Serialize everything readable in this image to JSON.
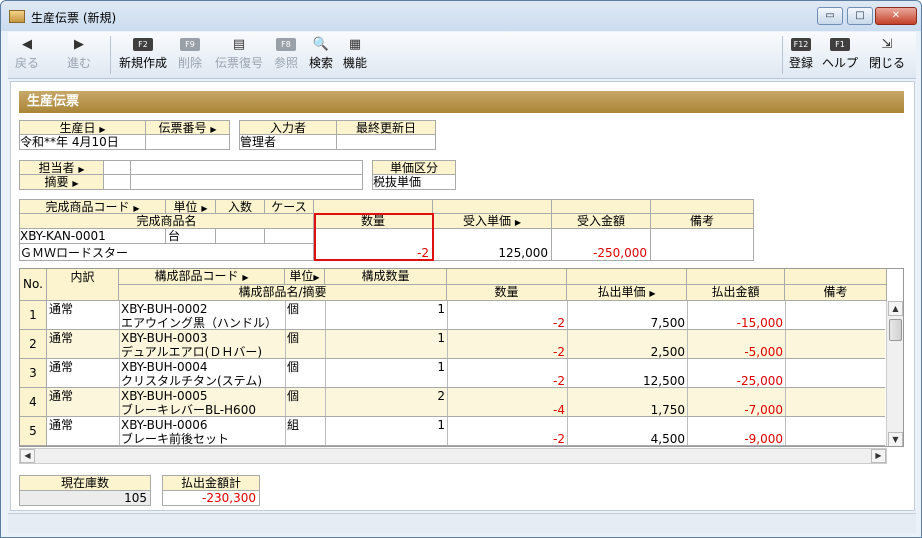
{
  "window": {
    "title": "生産伝票 (新規)",
    "min": "▭",
    "max": "□",
    "close": "✕"
  },
  "toolbar": {
    "back": {
      "label": "戻る",
      "icon": "◀"
    },
    "forward": {
      "label": "進む",
      "icon": "▶"
    },
    "new": {
      "label": "新規作成",
      "key": "F2"
    },
    "delete": {
      "label": "削除",
      "key": "F9"
    },
    "restore": {
      "label": "伝票復号",
      "icon": "▤"
    },
    "refer": {
      "label": "参照",
      "key": "F8"
    },
    "search": {
      "label": "検索",
      "icon": "🔍"
    },
    "function": {
      "label": "機能",
      "icon": "▦"
    },
    "register": {
      "label": "登録",
      "key": "F12"
    },
    "help": {
      "label": "ヘルプ",
      "key": "F1"
    },
    "close": {
      "label": "閉じる",
      "icon": "⇲"
    }
  },
  "section_title": "生産伝票",
  "header": {
    "prod_date_label": "生産日",
    "slip_no_label": "伝票番号",
    "prod_date": "令和**年 4月10日",
    "slip_no": "",
    "inputter_label": "入力者",
    "last_update_label": "最終更新日",
    "inputter": "管理者",
    "last_update": "",
    "person_label": "担当者",
    "summary_label": "摘要",
    "price_type_label": "単価区分",
    "price_type": "税抜単価"
  },
  "product": {
    "code_label": "完成商品コード",
    "unit_label": "単位",
    "qty_label": "入数",
    "case_label": "ケース",
    "name_label": "完成商品名",
    "quantity_label": "数量",
    "price_label": "受入単価",
    "amount_label": "受入金額",
    "note_label": "備考",
    "code": "XBY-KAN-0001",
    "unit": "台",
    "name": "ＧＭＷロードスター",
    "quantity": "-2",
    "price": "125,000",
    "amount": "-250,000"
  },
  "grid": {
    "headers": {
      "no": "No.",
      "kind": "内訳",
      "code": "構成部品コード",
      "unit": "単位",
      "comp_qty": "構成数量",
      "name": "構成部品名/摘要",
      "quantity": "数量",
      "price": "払出単価",
      "amount": "払出金額",
      "note": "備考"
    },
    "rows": [
      {
        "no": "1",
        "kind": "通常",
        "code": "XBY-BUH-0002",
        "unit": "個",
        "comp_qty": "1",
        "name": "エアウイング黒（ハンドル）",
        "quantity": "-2",
        "price": "7,500",
        "amount": "-15,000"
      },
      {
        "no": "2",
        "kind": "通常",
        "code": "XBY-BUH-0003",
        "unit": "個",
        "comp_qty": "1",
        "name": "デュアルエアロ(ＤＨバー)",
        "quantity": "-2",
        "price": "2,500",
        "amount": "-5,000"
      },
      {
        "no": "3",
        "kind": "通常",
        "code": "XBY-BUH-0004",
        "unit": "個",
        "comp_qty": "1",
        "name": "クリスタルチタン(ステム)",
        "quantity": "-2",
        "price": "12,500",
        "amount": "-25,000"
      },
      {
        "no": "4",
        "kind": "通常",
        "code": "XBY-BUH-0005",
        "unit": "個",
        "comp_qty": "2",
        "name": "ブレーキレバーBL-H600",
        "quantity": "-4",
        "price": "1,750",
        "amount": "-7,000"
      },
      {
        "no": "5",
        "kind": "通常",
        "code": "XBY-BUH-0006",
        "unit": "組",
        "comp_qty": "1",
        "name": "ブレーキ前後セット",
        "quantity": "-2",
        "price": "4,500",
        "amount": "-9,000"
      }
    ]
  },
  "footer": {
    "stock_label": "現在庫数",
    "stock": "105",
    "total_label": "払出金額計",
    "total": "-230,300"
  },
  "colors": {
    "header_bg": "#fbf4cf",
    "section_bar": "#b48f42",
    "negative": "#e00000",
    "highlight": "#e01010"
  }
}
